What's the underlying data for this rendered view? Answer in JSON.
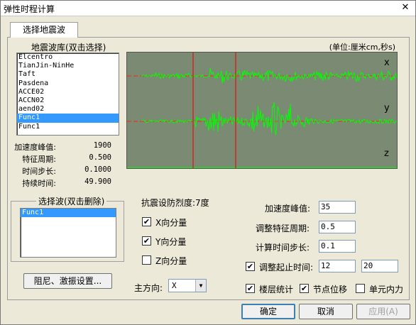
{
  "window": {
    "title": "弹性时程计算",
    "close_glyph": "✕"
  },
  "tabs": [
    {
      "label": "选择地震波"
    }
  ],
  "library": {
    "label": "地震波库(双击选择)",
    "items": [
      "Elcentro",
      "TianJin-NinHe",
      "Taft",
      "Pasdena",
      "ACCE02",
      "ACCN02",
      "aend02",
      "Func1",
      "Func1"
    ],
    "selected_index": 7
  },
  "wave_info": {
    "peak_label": "加速度峰值:",
    "peak_value": "1900",
    "period_label": "特征周期:",
    "period_value": "0.500",
    "step_label": "时间步长:",
    "step_value": "0.1000",
    "duration_label": "持续时间:",
    "duration_value": "49.900"
  },
  "selected_waves": {
    "label": "选择波(双击删除)",
    "items": [
      "Func1"
    ],
    "selected_index": 0
  },
  "damping_button": "阻尼、激振设置...",
  "plot": {
    "units": "(单位:厘米cm,秒s)",
    "axes": [
      "x",
      "y",
      "z"
    ],
    "colors": {
      "background": "#7a8a73",
      "signal": "#00ff00",
      "baseline_x": "#ff2020",
      "baseline_z": "#00ff00",
      "marker": "#e01010"
    }
  },
  "seismic": {
    "intensity_label": "抗震设防烈度:7度",
    "x_component": {
      "label": "X向分量",
      "checked": true
    },
    "y_component": {
      "label": "Y向分量",
      "checked": true
    },
    "z_component": {
      "label": "Z向分量",
      "checked": false
    },
    "main_direction_label": "主方向:",
    "main_direction_value": "X"
  },
  "params": {
    "peak_label": "加速度峰值:",
    "peak_value": "35",
    "period_label": "调整特征周期:",
    "period_value": "0.5",
    "step_label": "计算时间步长:",
    "step_value": "0.1",
    "range_label": "调整起止时间:",
    "range_checked": true,
    "range_start": "12",
    "range_end": "20"
  },
  "outputs": {
    "floor_stats": {
      "label": "楼层统计",
      "checked": true
    },
    "node_disp": {
      "label": "节点位移",
      "checked": true
    },
    "element_force": {
      "label": "单元内力",
      "checked": false
    }
  },
  "footer": {
    "ok": "确定",
    "cancel": "取消",
    "apply": "应用(A)"
  }
}
